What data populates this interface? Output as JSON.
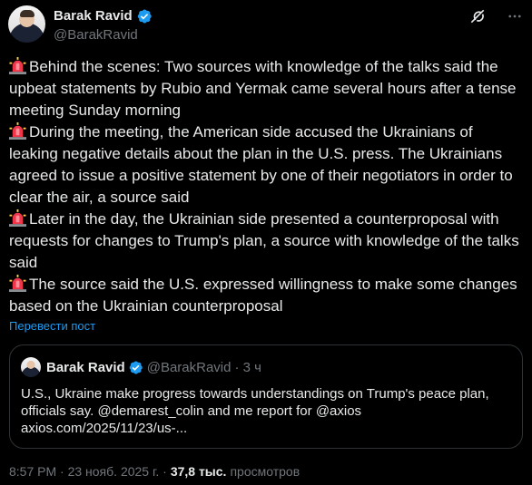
{
  "author": {
    "name": "Barak Ravid",
    "handle": "@BarakRavid"
  },
  "icons": {
    "verified": "verified-badge-icon",
    "grok": "grok-icon",
    "more": "more-options-icon",
    "siren": "rotating-light-emoji"
  },
  "colors": {
    "background": "#000000",
    "text": "#e7e9ea",
    "muted": "#71767b",
    "accent": "#1d9bf0",
    "border": "#2f3336"
  },
  "post": {
    "paragraphs": [
      "Behind the scenes: Two sources with knowledge of the talks said the upbeat statements by Rubio and Yermak came several hours after a tense meeting Sunday morning",
      "During the meeting, the American side accused the Ukrainians of leaking negative details about the plan in the U.S. press. The Ukrainians agreed to issue a positive statement by one of their negotiators in order to clear the air, a source said",
      "Later in the day, the Ukrainian side presented a counterproposal with requests for changes to Trump's plan, a source with knowledge of the talks said",
      "The source said the U.S. expressed willingness to make some changes based on the Ukrainian counterproposal"
    ],
    "translate_label": "Перевести пост"
  },
  "quote": {
    "name": "Barak Ravid",
    "handle": "@BarakRavid",
    "time": "· 3 ч",
    "text": "U.S., Ukraine make progress towards understandings on Trump's peace plan, officials say. @demarest_colin and me report for @axios axios.com/2025/11/23/us-..."
  },
  "footer": {
    "timestamp": "8:57 PM · 23 нояб. 2025 г. ·",
    "views_count": "37,8 тыс.",
    "views_label": "просмотров"
  }
}
